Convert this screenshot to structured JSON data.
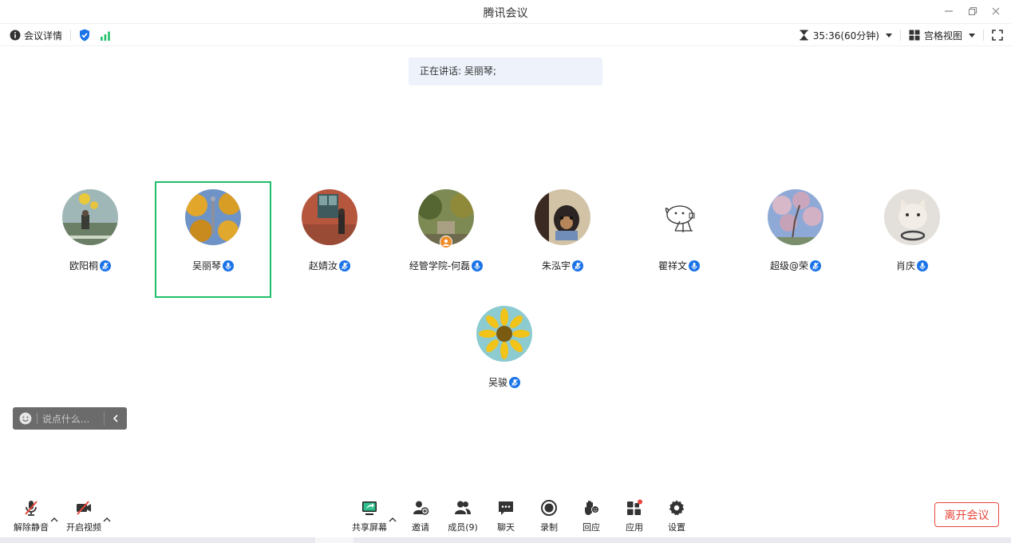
{
  "window": {
    "title": "腾讯会议"
  },
  "infobar": {
    "details_label": "会议详情",
    "timer": "35:36(60分钟)",
    "view_label": "宫格视图"
  },
  "speaking": {
    "text": "正在讲话: 吴丽琴;"
  },
  "participants": [
    {
      "name": "欧阳桐",
      "mic": "muted"
    },
    {
      "name": "吴丽琴",
      "mic": "on",
      "active": true
    },
    {
      "name": "赵婧汝",
      "mic": "muted"
    },
    {
      "name": "经管学院-何磊",
      "mic": "on",
      "host": true
    },
    {
      "name": "朱泓宇",
      "mic": "muted"
    },
    {
      "name": "瞿祥文",
      "mic": "on"
    },
    {
      "name": "超级@荣",
      "mic": "muted"
    },
    {
      "name": "肖庆",
      "mic": "on"
    },
    {
      "name": "吴骏",
      "mic": "muted"
    }
  ],
  "chat": {
    "placeholder": "说点什么..."
  },
  "toolbar": {
    "unmute": "解除静音",
    "start_video": "开启视频",
    "share_screen": "共享屏幕",
    "invite": "邀请",
    "members": "成员(9)",
    "chat": "聊天",
    "record": "录制",
    "react": "回应",
    "apps": "应用",
    "settings": "设置",
    "leave": "离开会议"
  },
  "colors": {
    "accent": "#1b73e8",
    "active_border": "#20c06a",
    "leave": "#e8473c",
    "signal": "#20c06a"
  }
}
